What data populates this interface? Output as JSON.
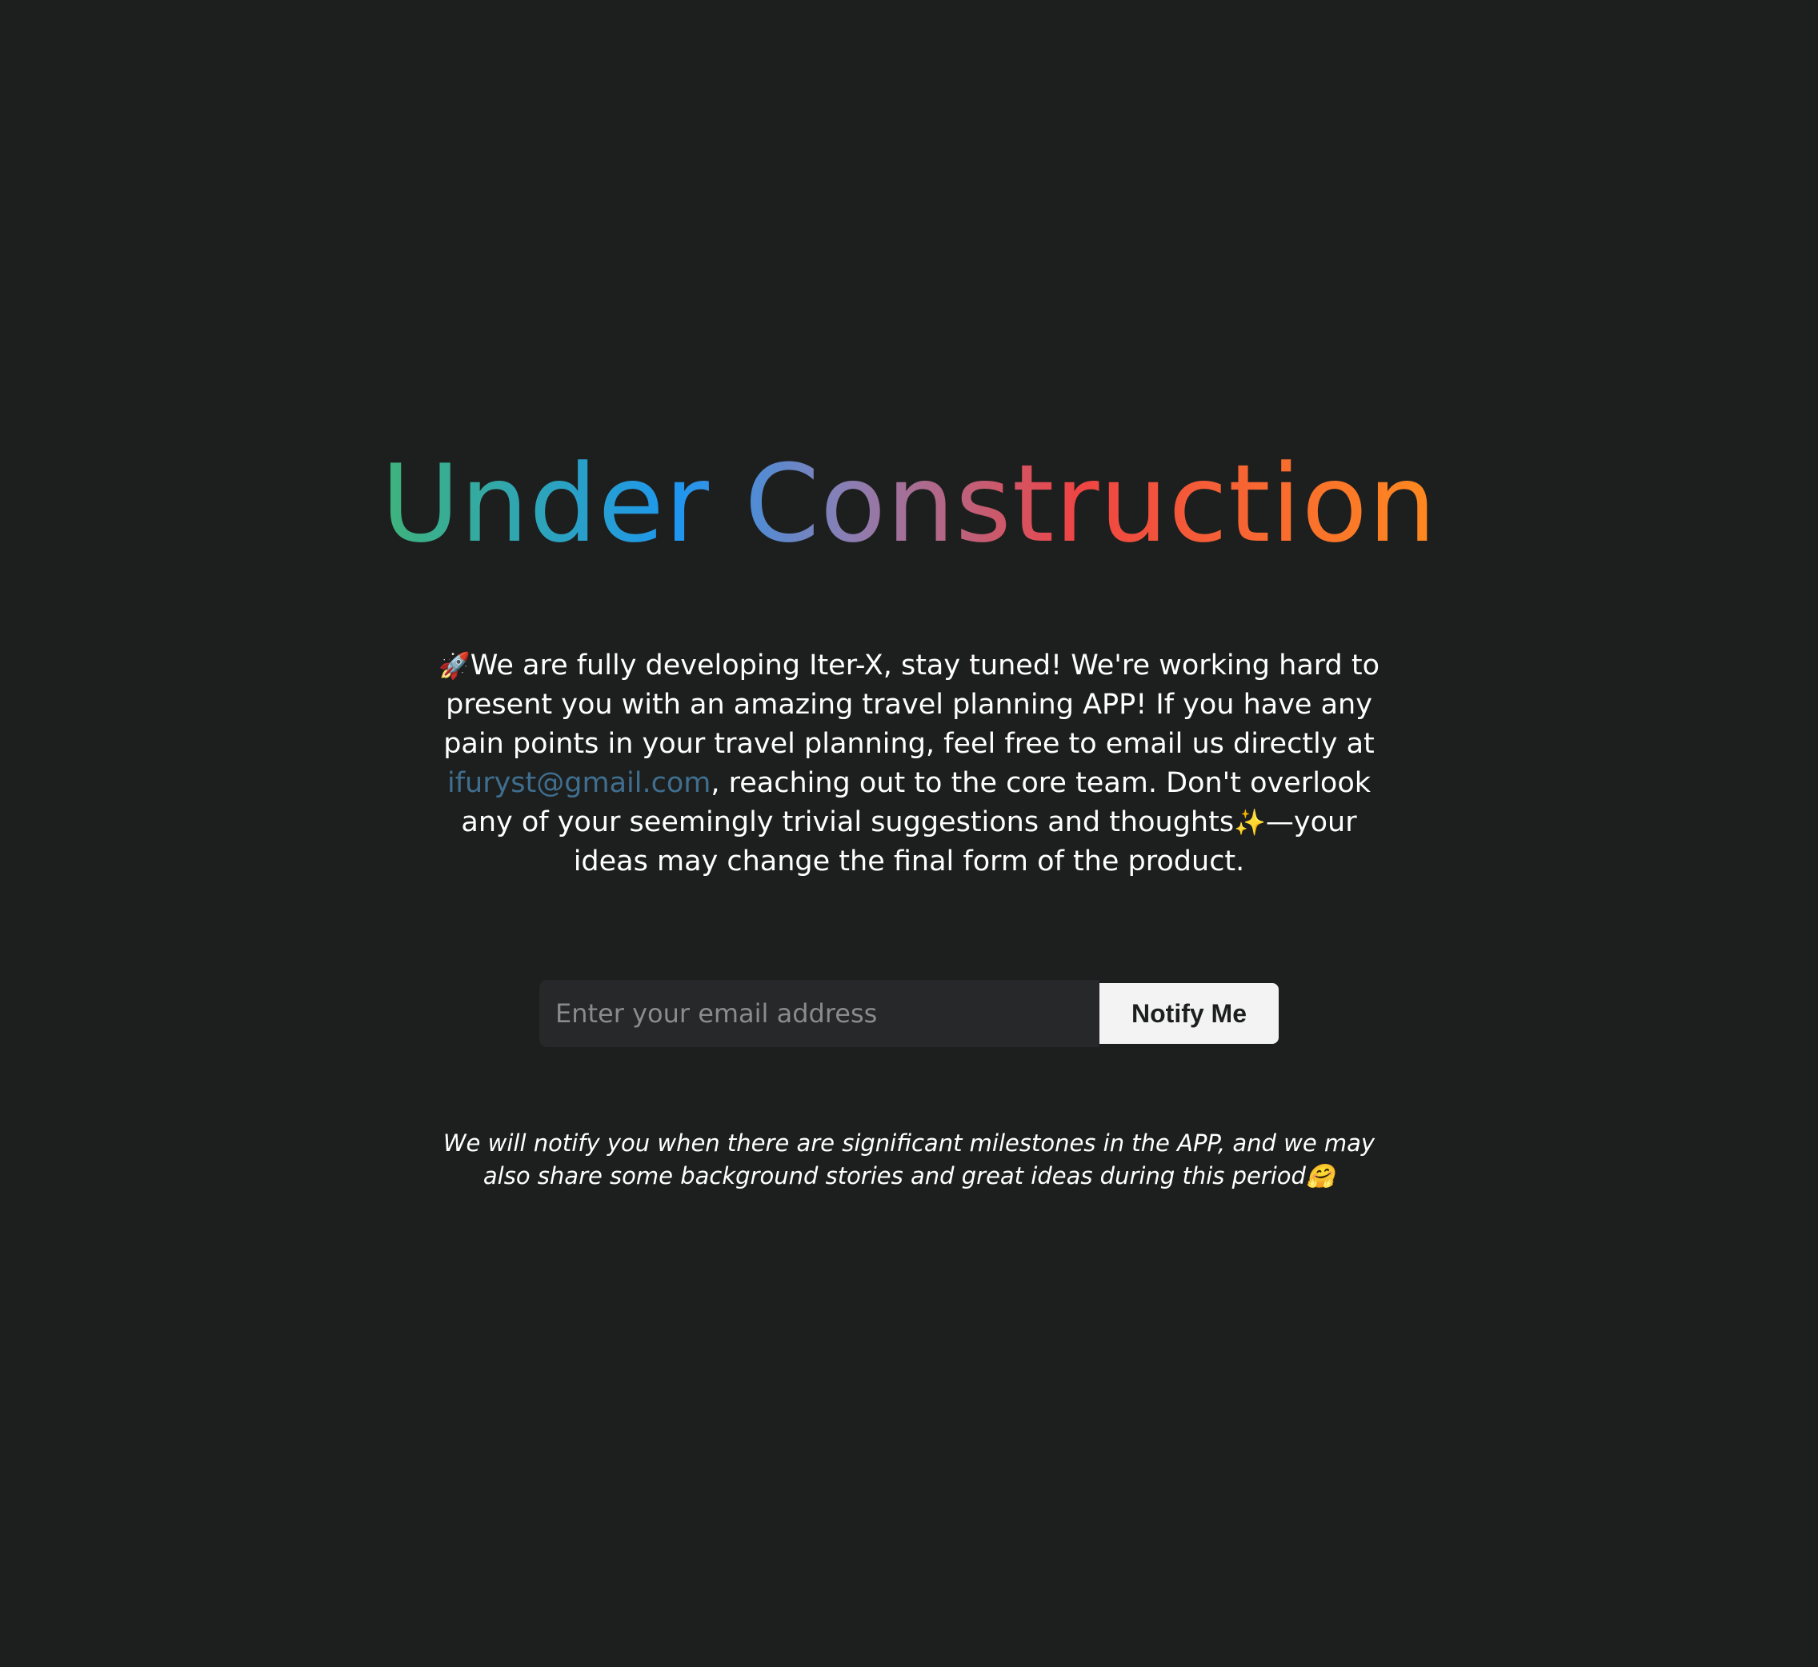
{
  "title": "Under Construction",
  "intro": {
    "emoji_rocket": "🚀",
    "text_before_email": "We are fully developing Iter-X, stay tuned! We're working hard to present you with an amazing travel planning APP! If you have any pain points in your travel planning, feel free to email us directly at ",
    "email": "ifuryst@gmail.com",
    "text_after_email": ", reaching out to the core team. Don't overlook any of your seemingly trivial suggestions and thoughts",
    "emoji_sparkles": "✨",
    "text_end": "—your ideas may change the final form of the product."
  },
  "form": {
    "email_placeholder": "Enter your email address",
    "email_value": "",
    "button_label": "Notify Me"
  },
  "footnote": {
    "text": "We will notify you when there are significant milestones in the APP, and we may also share some background stories and great ideas during this period",
    "emoji": "🤗"
  },
  "colors": {
    "background": "#1d1f1e",
    "link": "#3f6e8f",
    "gradient": [
      "#3fb37a",
      "#1e97f0",
      "#8a7fb4",
      "#ef4444",
      "#ff8a1e"
    ]
  }
}
